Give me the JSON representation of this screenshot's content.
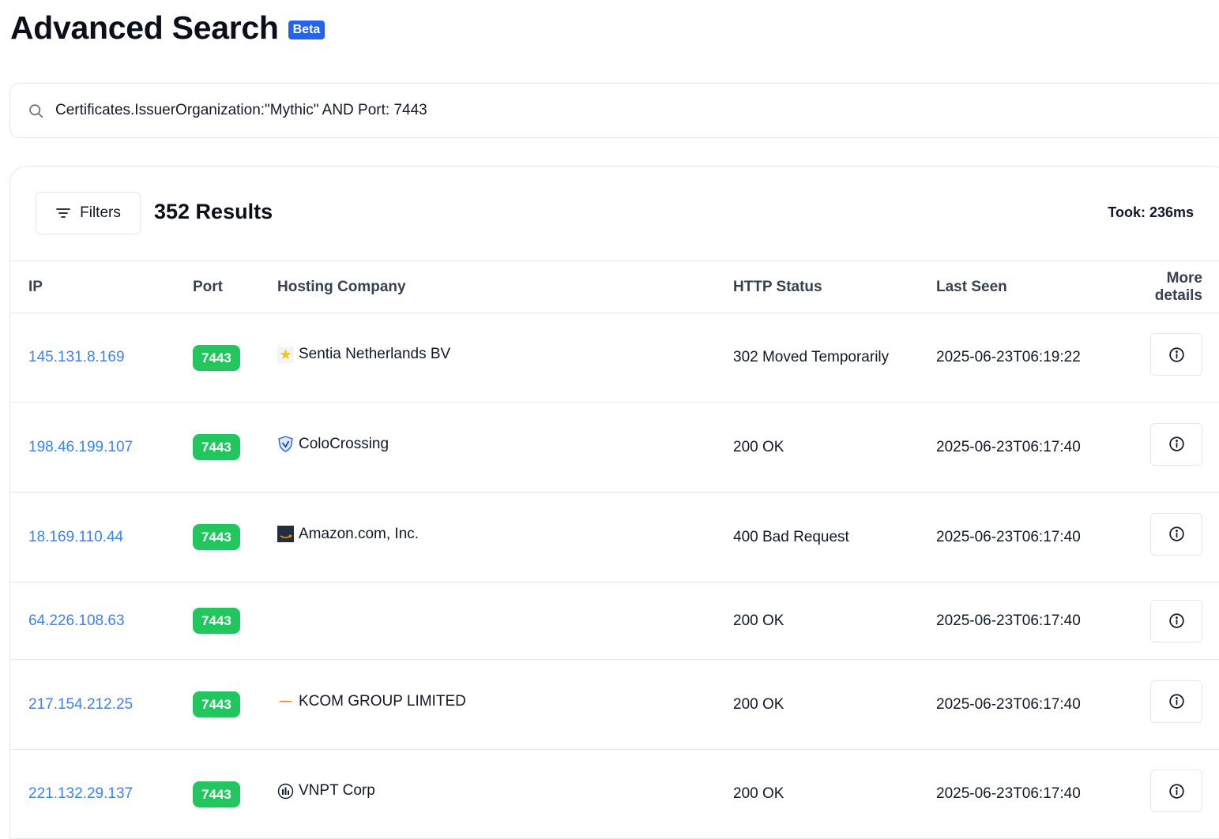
{
  "header": {
    "title": "Advanced Search",
    "badge": "Beta"
  },
  "search": {
    "value": "Certificates.IssuerOrganization:\"Mythic\" AND Port: 7443",
    "icon": "search-icon"
  },
  "results": {
    "filters_label": "Filters",
    "count_text": "352 Results",
    "took_text": "Took: 236ms",
    "columns": [
      "IP",
      "Port",
      "Hosting Company",
      "HTTP Status",
      "Last Seen",
      "More details"
    ],
    "rows": [
      {
        "ip": "145.131.8.169",
        "port": "7443",
        "host": "Sentia Netherlands BV",
        "host_icon": "sentia-logo",
        "status": "302 Moved Temporarily",
        "last_seen": "2025-06-23T06:19:22"
      },
      {
        "ip": "198.46.199.107",
        "port": "7443",
        "host": "ColoCrossing",
        "host_icon": "colocrossing-shield-logo",
        "status": "200 OK",
        "last_seen": "2025-06-23T06:17:40"
      },
      {
        "ip": "18.169.110.44",
        "port": "7443",
        "host": "Amazon.com, Inc.",
        "host_icon": "amazon-logo",
        "status": "400 Bad Request",
        "last_seen": "2025-06-23T06:17:40"
      },
      {
        "ip": "64.226.108.63",
        "port": "7443",
        "host": "",
        "host_icon": "",
        "status": "200 OK",
        "last_seen": "2025-06-23T06:17:40"
      },
      {
        "ip": "217.154.212.25",
        "port": "7443",
        "host": "KCOM GROUP LIMITED",
        "host_icon": "kcom-logo",
        "status": "200 OK",
        "last_seen": "2025-06-23T06:17:40"
      },
      {
        "ip": "221.132.29.137",
        "port": "7443",
        "host": "VNPT Corp",
        "host_icon": "vnpt-logo",
        "status": "200 OK",
        "last_seen": "2025-06-23T06:17:40"
      }
    ]
  },
  "colors": {
    "accent": "#2563eb",
    "link": "#3b82f6",
    "port_badge": "#22c55e",
    "border": "#e5e7eb"
  }
}
